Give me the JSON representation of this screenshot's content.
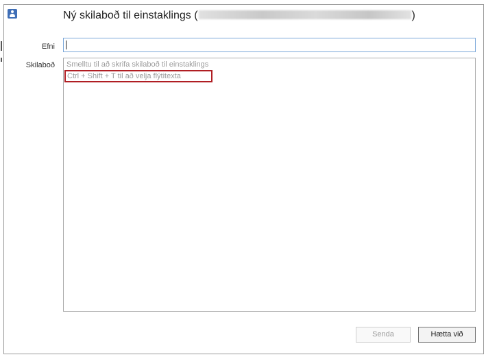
{
  "dialog": {
    "title_prefix": "Ný skilaboð til einstaklings (",
    "title_suffix": ")"
  },
  "form": {
    "subject_label": "Efni",
    "subject_value": "",
    "message_label": "Skilaboð",
    "message_placeholder": "Smelltu til að skrifa skilaboð til einstaklings",
    "quicktext_hint": "Ctrl + Shift + T til að velja flýtitexta"
  },
  "buttons": {
    "send_label": "Senda",
    "cancel_label": "Hætta við"
  },
  "colors": {
    "highlight_border": "#b01e23",
    "focus_border": "#7aa7d9",
    "app_icon": "#3f6eb6"
  },
  "icons": {
    "app_icon": "person-card-icon"
  }
}
